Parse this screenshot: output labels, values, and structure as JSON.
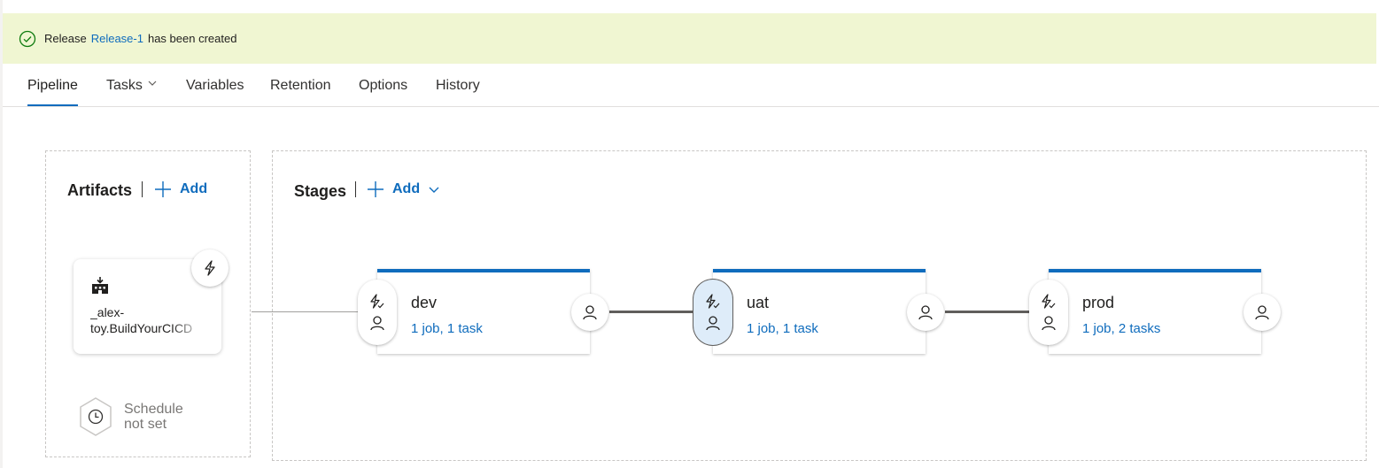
{
  "banner": {
    "prefix": "Release",
    "release_link": "Release-1",
    "suffix": "has been created"
  },
  "tabs": [
    {
      "label": "Pipeline",
      "active": true
    },
    {
      "label": "Tasks",
      "has_dropdown": true
    },
    {
      "label": "Variables"
    },
    {
      "label": "Retention"
    },
    {
      "label": "Options"
    },
    {
      "label": "History"
    }
  ],
  "artifacts": {
    "title": "Artifacts",
    "add_label": "Add",
    "items": [
      {
        "name_line1": "_alex-",
        "name_line2": "toy.BuildYourCICD",
        "icon": "build-pipeline-icon"
      }
    ],
    "schedule": {
      "line1": "Schedule",
      "line2": "not set"
    }
  },
  "stages": {
    "title": "Stages",
    "add_label": "Add",
    "items": [
      {
        "name": "dev",
        "meta": "1 job, 1 task"
      },
      {
        "name": "uat",
        "meta": "1 job, 1 task",
        "selected": true
      },
      {
        "name": "prod",
        "meta": "1 job, 2 tasks"
      }
    ]
  },
  "colors": {
    "accent": "#0f6cbd",
    "banner_bg": "#f0f6d2",
    "selected_bg": "#deecf9"
  }
}
